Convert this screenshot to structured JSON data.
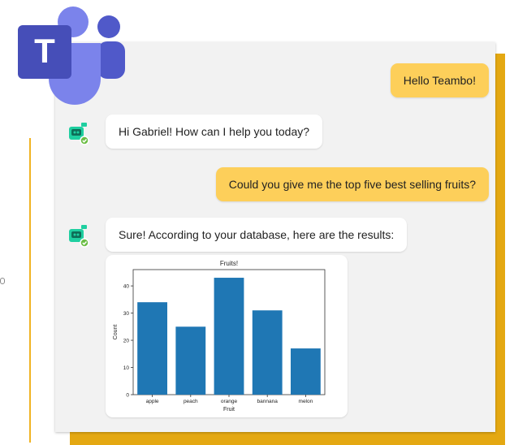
{
  "app": {
    "logo_letter": "T",
    "icon": "microsoft-teams-logo"
  },
  "colors": {
    "user_bubble": "#fdcf5a",
    "bot_bubble": "#ffffff",
    "panel": "#f2f2f2",
    "accent_gold": "#e4a812",
    "bar": "#1f77b4",
    "teams_purple": "#5059c9",
    "teams_dark": "#464eb8"
  },
  "messages": [
    {
      "sender": "user",
      "text": "Hello Teambo!"
    },
    {
      "sender": "bot",
      "text": "Hi Gabriel! How can I help you today?",
      "icon": "robot-avatar-icon"
    },
    {
      "sender": "user",
      "text": "Could you give me the top five best selling fruits?"
    },
    {
      "sender": "bot",
      "text": "Sure! According to your database, here are the results:",
      "icon": "robot-avatar-icon"
    }
  ],
  "chart_data": {
    "type": "bar",
    "title": "Fruits!",
    "xlabel": "Fruit",
    "ylabel": "Count",
    "categories": [
      "apple",
      "peach",
      "orange",
      "bannana",
      "melon"
    ],
    "values": [
      34,
      25,
      43,
      31,
      17
    ],
    "ylim": [
      0,
      46
    ],
    "yticks": [
      0,
      10,
      20,
      30,
      40
    ],
    "grid": false
  }
}
